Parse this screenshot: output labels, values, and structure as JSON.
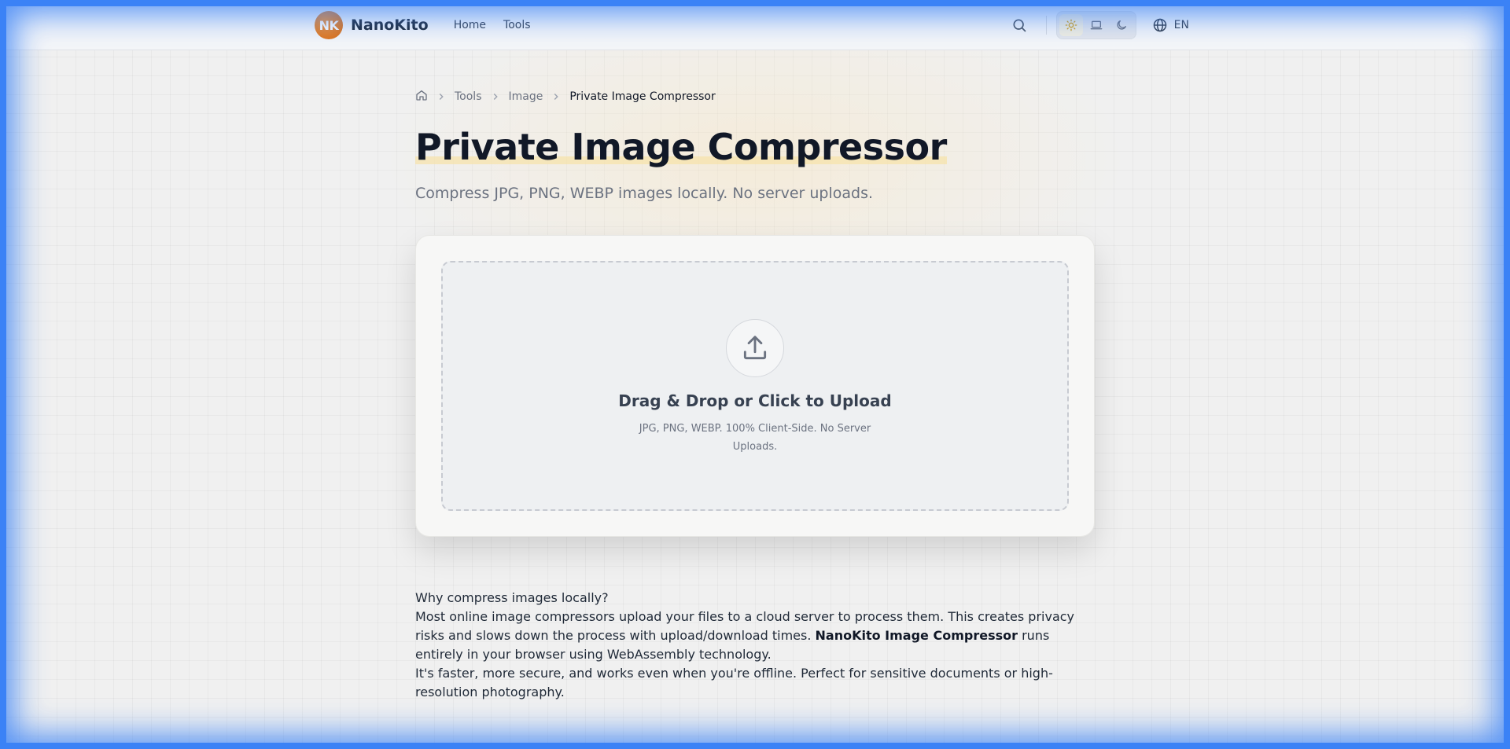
{
  "brand": {
    "badge": "NK",
    "name": "NanoKito"
  },
  "nav": [
    {
      "label": "Home"
    },
    {
      "label": "Tools"
    }
  ],
  "header": {
    "language": "EN",
    "theme_active": "light"
  },
  "breadcrumb": {
    "items": [
      "Tools",
      "Image"
    ],
    "current": "Private Image Compressor"
  },
  "page": {
    "title": "Private Image Compressor",
    "subtitle": "Compress JPG, PNG, WEBP images locally. No server uploads."
  },
  "upload": {
    "title": "Drag & Drop or Click to Upload",
    "subtitle": "JPG, PNG, WEBP. 100% Client-Side. No Server Uploads."
  },
  "info": {
    "heading": "Why compress images locally?",
    "p1_before": "Most online image compressors upload your files to a cloud server to process them. This creates privacy risks and slows down the process with upload/download times. ",
    "p1_bold": "NanoKito Image Compressor",
    "p1_after": " runs entirely in your browser using WebAssembly technology.",
    "p2": "It's faster, more secure, and works even when you're offline. Perfect for sensitive documents or high-resolution photography."
  },
  "colors": {
    "accent": "#e07a1f",
    "frame": "#3b82f6",
    "highlight": "#f7e2a8"
  }
}
